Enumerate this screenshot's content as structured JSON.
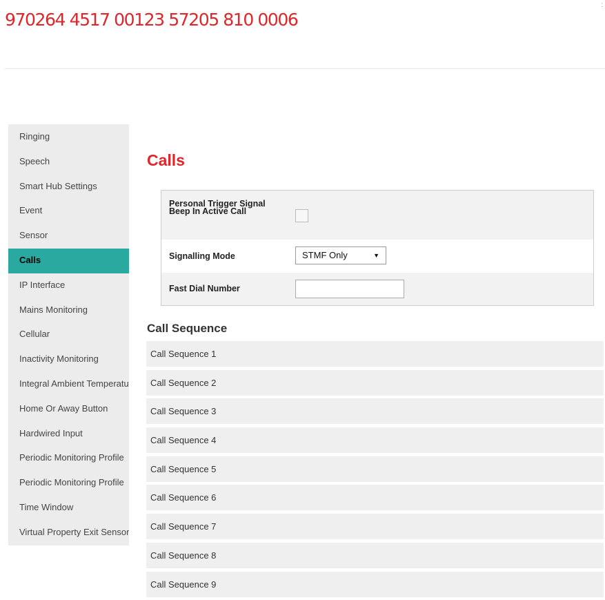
{
  "header": {
    "device_id": "970264 4517 00123 57205 810 0006"
  },
  "sidebar": {
    "items": [
      {
        "label": "Ringing"
      },
      {
        "label": "Speech"
      },
      {
        "label": "Smart Hub Settings"
      },
      {
        "label": "Event"
      },
      {
        "label": "Sensor"
      },
      {
        "label": "Calls",
        "active": true
      },
      {
        "label": "IP Interface"
      },
      {
        "label": "Mains Monitoring"
      },
      {
        "label": "Cellular"
      },
      {
        "label": "Inactivity Monitoring"
      },
      {
        "label": "Integral Ambient Temperature"
      },
      {
        "label": "Home Or Away Button"
      },
      {
        "label": "Hardwired Input"
      },
      {
        "label": "Periodic Monitoring Profile"
      },
      {
        "label": "Periodic Monitoring Profile"
      },
      {
        "label": "Time Window"
      },
      {
        "label": "Virtual Property Exit Sensor"
      }
    ]
  },
  "main": {
    "title": "Calls",
    "settings": {
      "personal_trigger_label": "Personal Trigger Signal Beep In Active Call",
      "personal_trigger_checked": false,
      "signalling_mode_label": "Signalling Mode",
      "signalling_mode_value": "STMF Only",
      "fast_dial_label": "Fast Dial Number",
      "fast_dial_value": ""
    },
    "call_sequence_heading": "Call Sequence",
    "call_sequences": [
      "Call Sequence 1",
      "Call Sequence 2",
      "Call Sequence 3",
      "Call Sequence 4",
      "Call Sequence 5",
      "Call Sequence 6",
      "Call Sequence 7",
      "Call Sequence 8",
      "Call Sequence 9"
    ]
  },
  "icons": {
    "dropdown": "caret-down-icon"
  },
  "colors": {
    "accent_red": "#e0262b",
    "active_teal": "#2aa9a0",
    "sidebar_bg": "#ececec"
  }
}
